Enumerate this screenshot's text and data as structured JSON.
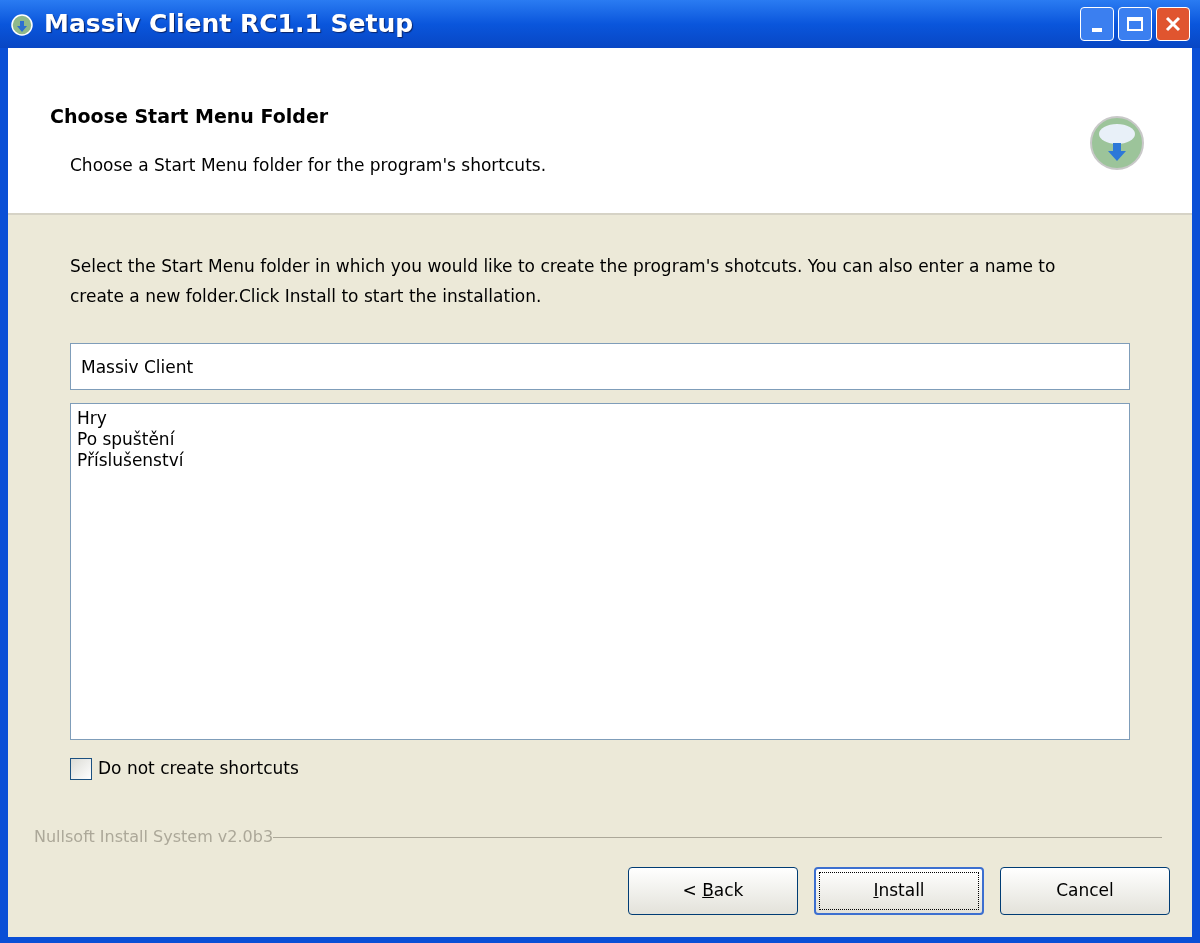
{
  "window": {
    "title": "Massiv Client RC1.1 Setup"
  },
  "header": {
    "title": "Choose Start Menu Folder",
    "subtitle": "Choose a Start Menu folder for the program's shortcuts."
  },
  "description": "Select the Start Menu folder in which you would like to create the program's shotcuts. You can also enter a name to create a new folder.Click Install to start the installation.",
  "folder_field": {
    "value": "Massiv Client"
  },
  "folder_list": [
    {
      "label": "Hry",
      "selected": false
    },
    {
      "label": "Po spuštění",
      "selected": false
    },
    {
      "label": "Příslušenství",
      "selected": false
    }
  ],
  "no_shortcuts": {
    "label": "Do not create shortcuts",
    "checked": false
  },
  "branding": "Nullsoft Install System v2.0b3",
  "buttons": [
    {
      "before": "< ",
      "key": "B",
      "after": "ack",
      "default": false
    },
    {
      "key": "I",
      "after": "nstall",
      "default": true
    },
    {
      "before": "Cancel",
      "default": false
    }
  ]
}
